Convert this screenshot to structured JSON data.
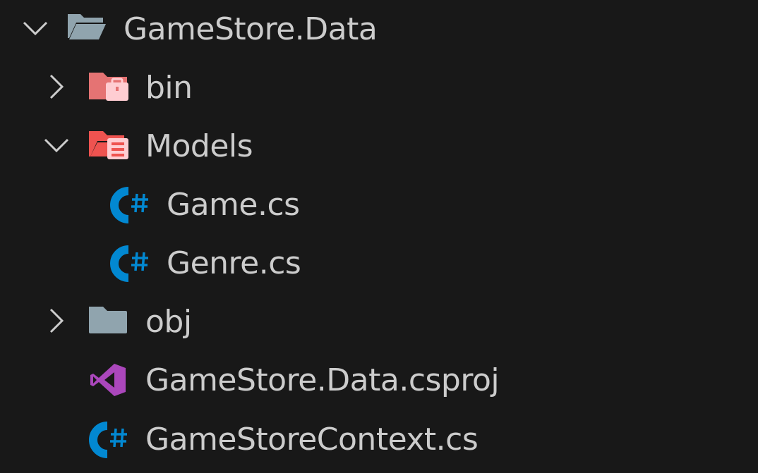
{
  "explorer": {
    "root": {
      "label": "GameStore.Data",
      "expanded": true,
      "icon": "folder-opened-icon",
      "color": "#90a4ae"
    },
    "items": [
      {
        "label": "bin",
        "type": "folder",
        "expanded": false,
        "icon": "bin-folder-icon",
        "color": "#e57373"
      },
      {
        "label": "Models",
        "type": "folder",
        "expanded": true,
        "icon": "models-folder-icon",
        "color": "#ef5350",
        "children": [
          {
            "label": "Game.cs",
            "type": "file",
            "icon": "csharp-icon",
            "color": "#0288d1"
          },
          {
            "label": "Genre.cs",
            "type": "file",
            "icon": "csharp-icon",
            "color": "#0288d1"
          }
        ]
      },
      {
        "label": "obj",
        "type": "folder",
        "expanded": false,
        "icon": "folder-icon",
        "color": "#90a4ae"
      },
      {
        "label": "GameStore.Data.csproj",
        "type": "file",
        "icon": "visual-studio-icon",
        "color": "#ab47bc"
      },
      {
        "label": "GameStoreContext.cs",
        "type": "file",
        "icon": "csharp-icon",
        "color": "#0288d1"
      }
    ]
  },
  "theme": {
    "background": "#181818",
    "text": "#cccccc",
    "chevron": "#cccccc"
  }
}
